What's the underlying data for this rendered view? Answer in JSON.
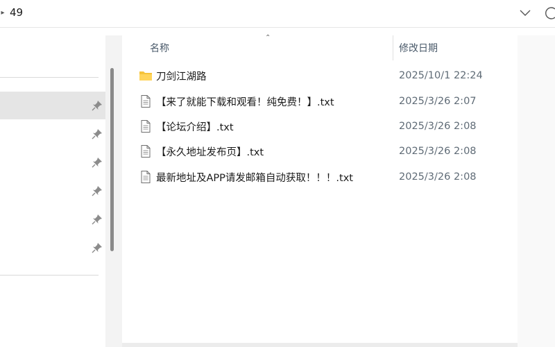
{
  "address_bar": {
    "crumb_label": "49"
  },
  "icons": {
    "breadcrumb_separator": "chevron-right-icon",
    "address_dropdown": "chevron-down-icon",
    "refresh": "refresh-icon",
    "pin": "pin-icon",
    "folder": "folder-icon",
    "text_file": "text-file-icon",
    "sort": "sort-up-icon"
  },
  "columns": {
    "name": "名称",
    "date_modified": "修改日期"
  },
  "files": [
    {
      "name": "刀剑江湖路",
      "date": "2025/10/1 22:24",
      "type": "folder"
    },
    {
      "name": "【来了就能下载和观看！纯免费！】.txt",
      "date": "2025/3/26 2:07",
      "type": "txt"
    },
    {
      "name": "【论坛介绍】.txt",
      "date": "2025/3/26 2:08",
      "type": "txt"
    },
    {
      "name": "【永久地址发布页】.txt",
      "date": "2025/3/26 2:08",
      "type": "txt"
    },
    {
      "name": "最新地址及APP请发邮箱自动获取！！！.txt",
      "date": "2025/3/26 2:08",
      "type": "txt"
    }
  ],
  "colors": {
    "folder_yellow": "#f5c33b",
    "selected_nav": "#e5e5e5",
    "header_text": "#4a5a6a",
    "date_text": "#5f6b76"
  }
}
